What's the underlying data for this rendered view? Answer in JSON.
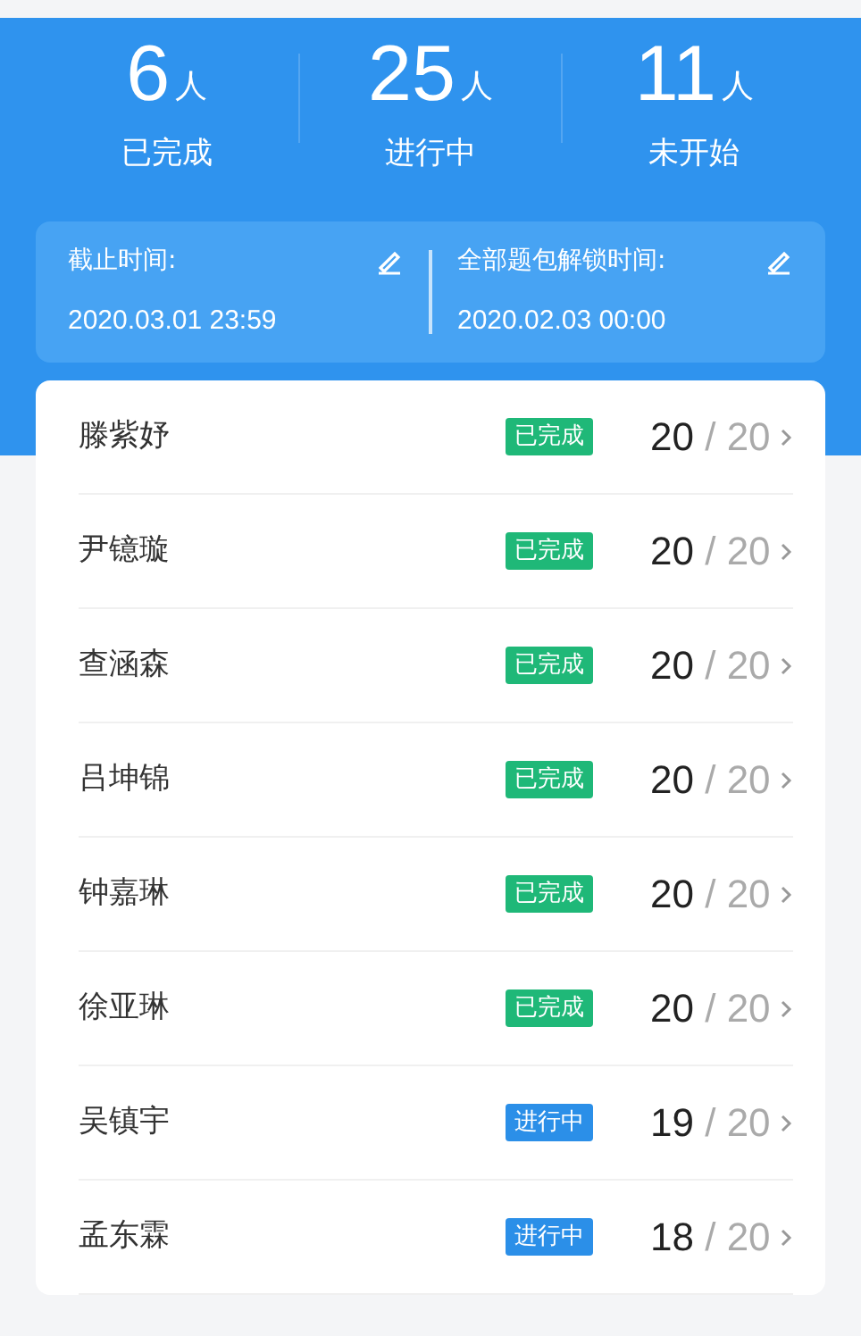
{
  "stats": [
    {
      "count": "6",
      "unit": "人",
      "label": "已完成"
    },
    {
      "count": "25",
      "unit": "人",
      "label": "进行中"
    },
    {
      "count": "11",
      "unit": "人",
      "label": "未开始"
    }
  ],
  "times": [
    {
      "label": "截止时间:",
      "value": "2020.03.01 23:59"
    },
    {
      "label": "全部题包解锁时间:",
      "value": "2020.02.03 00:00"
    }
  ],
  "students": [
    {
      "name": "滕紫妤",
      "kind": "done",
      "status": "已完成",
      "score": "20",
      "total": "/ 20"
    },
    {
      "name": "尹镱璇",
      "kind": "done",
      "status": "已完成",
      "score": "20",
      "total": "/ 20"
    },
    {
      "name": "查涵森",
      "kind": "done",
      "status": "已完成",
      "score": "20",
      "total": "/ 20"
    },
    {
      "name": "吕坤锦",
      "kind": "done",
      "status": "已完成",
      "score": "20",
      "total": "/ 20"
    },
    {
      "name": "钟嘉琳",
      "kind": "done",
      "status": "已完成",
      "score": "20",
      "total": "/ 20"
    },
    {
      "name": "徐亚琳",
      "kind": "done",
      "status": "已完成",
      "score": "20",
      "total": "/ 20"
    },
    {
      "name": "吴镇宇",
      "kind": "progress",
      "status": "进行中",
      "score": "19",
      "total": "/ 20"
    },
    {
      "name": "孟东霖",
      "kind": "progress",
      "status": "进行中",
      "score": "18",
      "total": "/ 20"
    }
  ]
}
